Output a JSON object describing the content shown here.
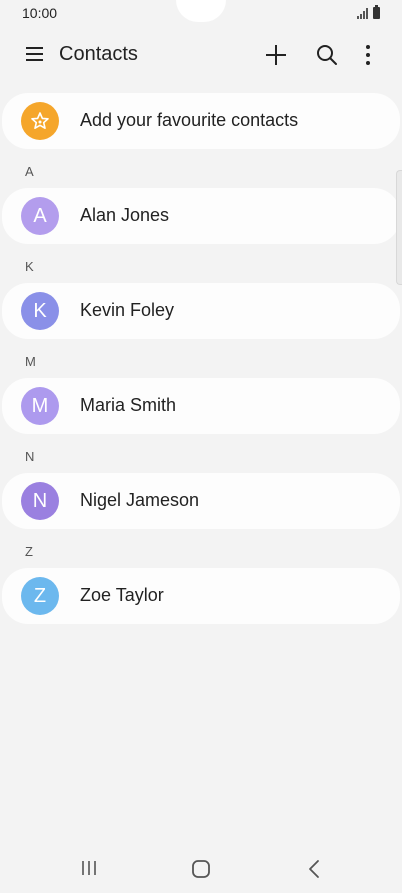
{
  "status_bar": {
    "time": "10:00"
  },
  "app_bar": {
    "title": "Contacts",
    "icons": [
      "menu-icon",
      "add-icon",
      "search-icon",
      "more-options-icon"
    ]
  },
  "favourites": {
    "label": "Add your favourite contacts",
    "icon": "star-icon",
    "color": "#f5a62b"
  },
  "sections": [
    {
      "letter": "A",
      "contact": {
        "initial": "A",
        "name": "Alan Jones",
        "color": "#b39ded"
      }
    },
    {
      "letter": "K",
      "contact": {
        "initial": "K",
        "name": "Kevin Foley",
        "color": "#8a90e8"
      }
    },
    {
      "letter": "M",
      "contact": {
        "initial": "M",
        "name": "Maria Smith",
        "color": "#ad9aee"
      }
    },
    {
      "letter": "N",
      "contact": {
        "initial": "N",
        "name": "Nigel Jameson",
        "color": "#9a80e0"
      }
    },
    {
      "letter": "Z",
      "contact": {
        "initial": "Z",
        "name": "Zoe Taylor",
        "color": "#6cb8ee"
      }
    }
  ],
  "nav_bar": {
    "icons": [
      "recents-icon",
      "home-icon",
      "back-icon"
    ]
  }
}
